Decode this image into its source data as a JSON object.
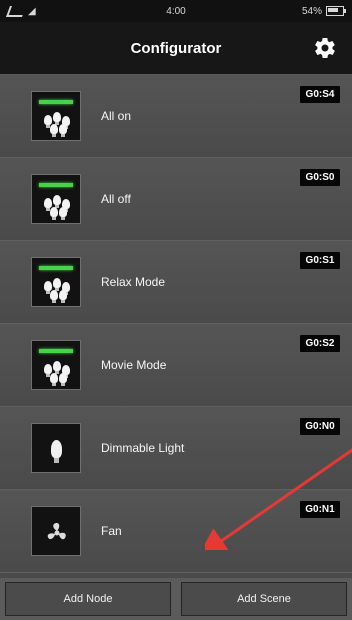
{
  "status_bar": {
    "time": "4:00",
    "battery": "54%"
  },
  "header": {
    "title": "Configurator",
    "settings_icon": "gear-icon"
  },
  "scenes": [
    {
      "label": "All on",
      "code": "G0:S4",
      "icon": "scene-lights-icon"
    },
    {
      "label": "All off",
      "code": "G0:S0",
      "icon": "scene-lights-icon"
    },
    {
      "label": "Relax Mode",
      "code": "G0:S1",
      "icon": "scene-lights-icon"
    },
    {
      "label": "Movie Mode",
      "code": "G0:S2",
      "icon": "scene-lights-icon"
    },
    {
      "label": "Dimmable Light",
      "code": "G0:N0",
      "icon": "bulb-icon"
    },
    {
      "label": "Fan",
      "code": "G0:N1",
      "icon": "fan-icon"
    }
  ],
  "bottom_bar": {
    "add_node": "Add Node",
    "add_scene": "Add Scene"
  },
  "colors": {
    "accent_green": "#46d34a",
    "arrow_red": "#e53935",
    "background": "#4a4a4a",
    "header": "#171717"
  }
}
